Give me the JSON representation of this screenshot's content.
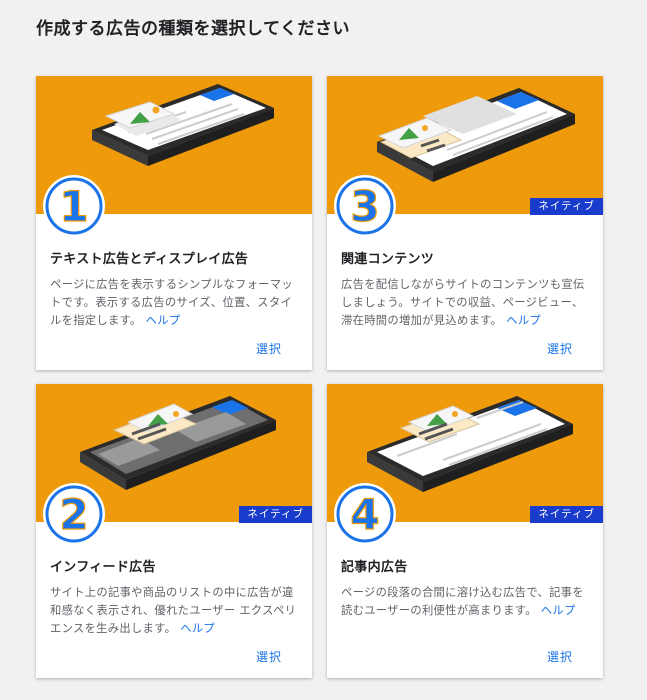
{
  "page_title": "作成する広告の種類を選択してください",
  "colors": {
    "illustration_bg": "#ee9a0b",
    "badge_bg": "#1a3ccc",
    "link": "#1a73e8",
    "number_badge": "#1a73e8"
  },
  "cards": [
    {
      "number": "1",
      "title": "テキスト広告とディスプレイ広告",
      "description": "ページに広告を表示するシンプルなフォーマットです。表示する広告のサイズ、位置、スタイルを指定します。",
      "help_label": "ヘルプ",
      "select_label": "選択",
      "badge": ""
    },
    {
      "number": "3",
      "title": "関連コンテンツ",
      "description": "広告を配信しながらサイトのコンテンツも宣伝しましょう。サイトでの収益、ページビュー、滞在時間の増加が見込めます。",
      "help_label": "ヘルプ",
      "select_label": "選択",
      "badge": "ネイティブ"
    },
    {
      "number": "2",
      "title": "インフィード広告",
      "description": "サイト上の記事や商品のリストの中に広告が違和感なく表示され、優れたユーザー エクスペリエンスを生み出します。",
      "help_label": "ヘルプ",
      "select_label": "選択",
      "badge": "ネイティブ"
    },
    {
      "number": "4",
      "title": "記事内広告",
      "description": "ページの段落の合間に溶け込む広告で、記事を読むユーザーの利便性が高まります。",
      "help_label": "ヘルプ",
      "select_label": "選択",
      "badge": "ネイティブ"
    }
  ]
}
